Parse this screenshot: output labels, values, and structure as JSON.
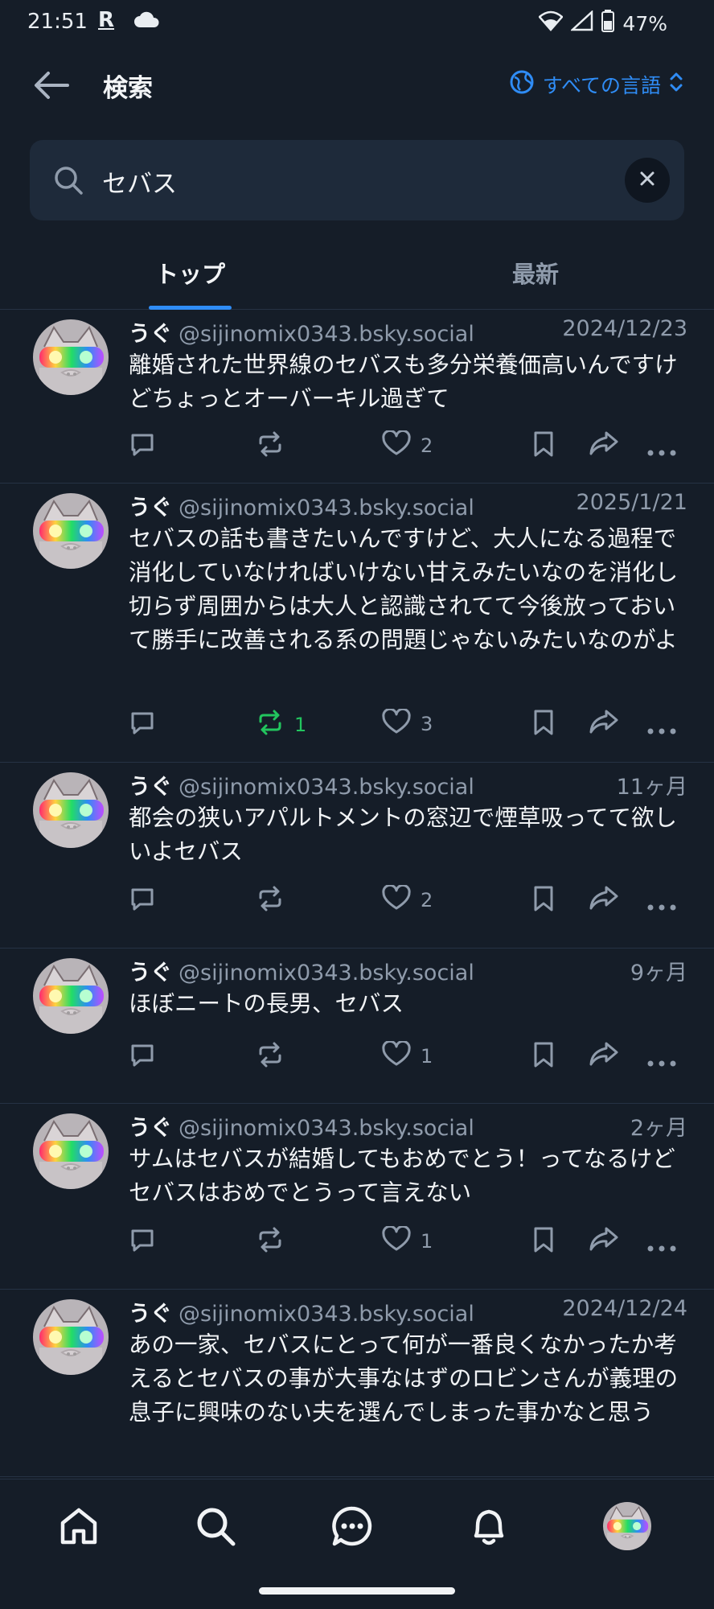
{
  "status_bar": {
    "time": "21:51",
    "carrier_mark": "R",
    "battery": "47%"
  },
  "header": {
    "title": "検索",
    "language_label": "すべての言語"
  },
  "search": {
    "value": "セバス",
    "placeholder": ""
  },
  "tabs": [
    {
      "label": "トップ"
    },
    {
      "label": "最新"
    }
  ],
  "colors": {
    "background": "#151d28",
    "accent": "#2f8cf5",
    "repost_active": "#22c55e",
    "muted": "#8f9bab"
  },
  "posts": [
    {
      "author": "うぐ",
      "handle": "@sijinomix0343.bsky.social",
      "time": "2024/12/23",
      "text": "離婚された世界線のセバスも多分栄養価高いんですけどちょっとオーバーキル過ぎて",
      "reposts": "",
      "likes": "2",
      "reposted": false
    },
    {
      "author": "うぐ",
      "handle": "@sijinomix0343.bsky.social",
      "time": "2025/1/21",
      "text": "セバスの話も書きたいんですけど、大人になる過程で消化していなければいけない甘えみたいなのを消化し切らず周囲からは大人と認識されてて今後放っておいて勝手に改善される系の問題じゃないみたいなのがよ",
      "reposts": "1",
      "likes": "3",
      "reposted": true
    },
    {
      "author": "うぐ",
      "handle": "@sijinomix0343.bsky.social",
      "time": "11ヶ月",
      "text": "都会の狭いアパルトメントの窓辺で煙草吸ってて欲しいよセバス",
      "reposts": "",
      "likes": "2",
      "reposted": false
    },
    {
      "author": "うぐ",
      "handle": "@sijinomix0343.bsky.social",
      "time": "9ヶ月",
      "text": "ほぼニートの長男、セバス",
      "reposts": "",
      "likes": "1",
      "reposted": false
    },
    {
      "author": "うぐ",
      "handle": "@sijinomix0343.bsky.social",
      "time": "2ヶ月",
      "text": "サムはセバスが結婚してもおめでとう！ってなるけどセバスはおめでとうって言えない",
      "reposts": "",
      "likes": "1",
      "reposted": false
    },
    {
      "author": "うぐ",
      "handle": "@sijinomix0343.bsky.social",
      "time": "2024/12/24",
      "text": "あの一家、セバスにとって何が一番良くなかったか考えるとセバスの事が大事なはずのロビンさんが義理の息子に興味のない夫を選んでしまった事かなと思う",
      "reposts": "",
      "likes": "",
      "reposted": false,
      "actions_visible": false
    }
  ],
  "icons": [
    "back-arrow-icon",
    "globe-icon",
    "chevron-updown-icon",
    "search-icon",
    "close-icon",
    "reply-icon",
    "repost-icon",
    "heart-icon",
    "bookmark-icon",
    "share-icon",
    "more-icon",
    "home-icon",
    "search-nav-icon",
    "chat-icon",
    "bell-icon",
    "avatar"
  ]
}
